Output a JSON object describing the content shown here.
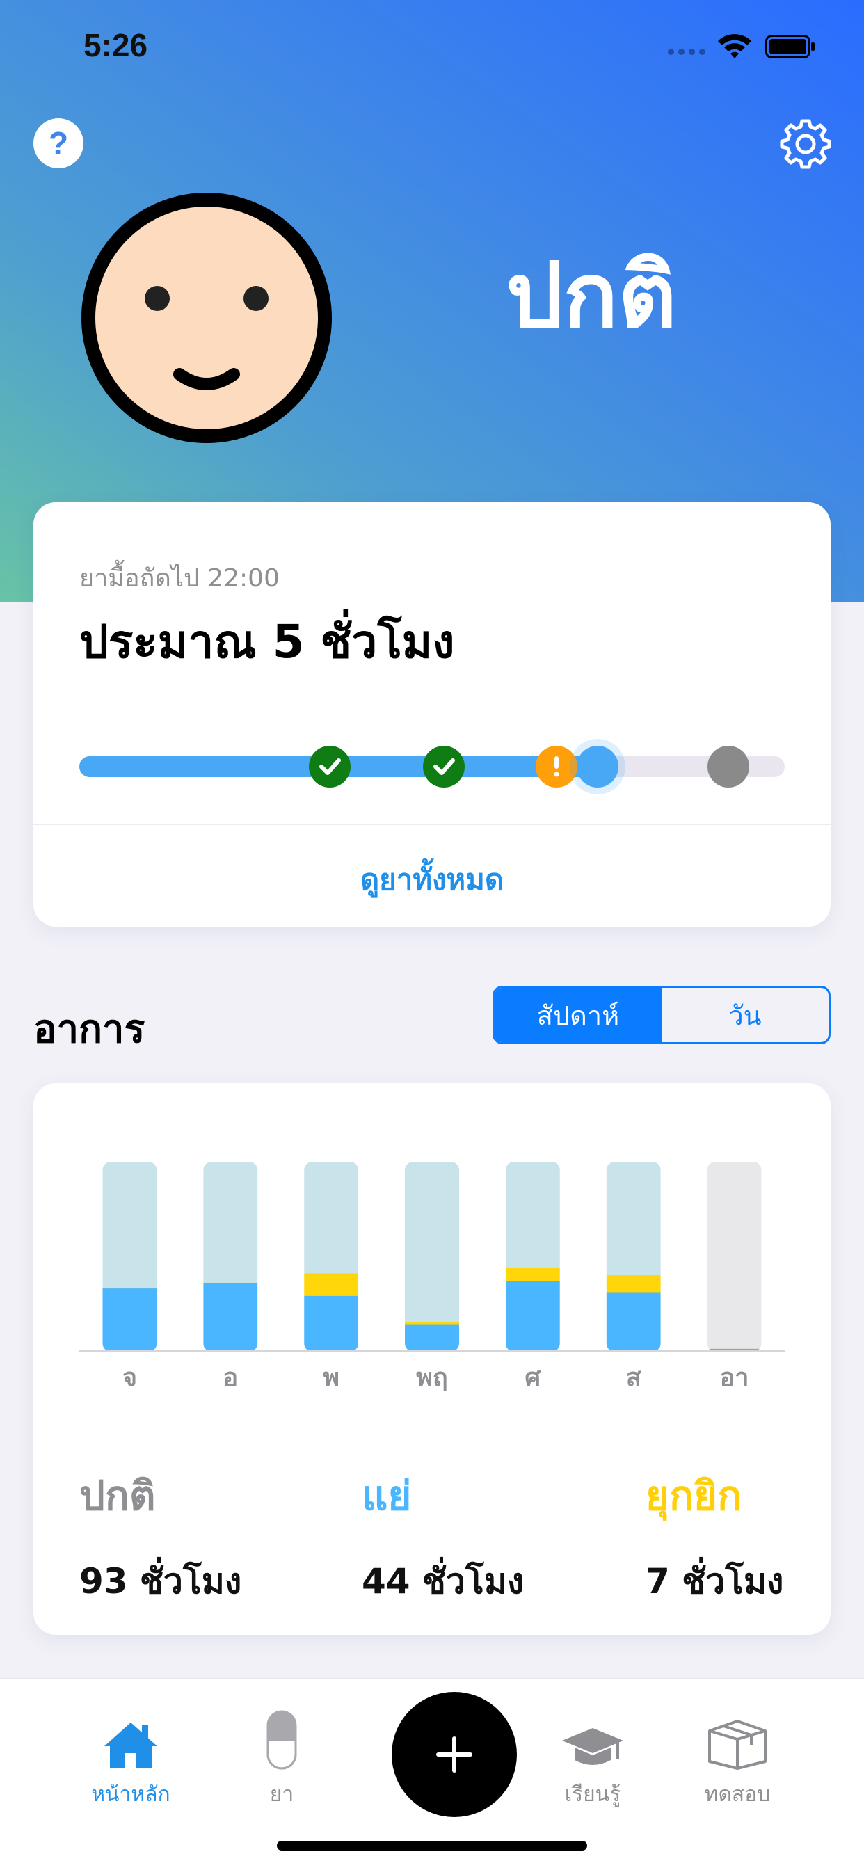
{
  "status_bar": {
    "time": "5:26"
  },
  "header": {
    "mood_label": "ปกติ"
  },
  "medication": {
    "next_label": "ยามื้อถัดไป 22:00",
    "time_remaining": "ประมาณ 5 ชั่วโมง",
    "see_all_label": "ดูยาทั้งหมด",
    "progress": 0.735,
    "doses": [
      {
        "status": "taken",
        "position": 0.355
      },
      {
        "status": "taken",
        "position": 0.517
      },
      {
        "status": "warning",
        "position": 0.677
      },
      {
        "status": "upcoming",
        "position": 0.92
      }
    ]
  },
  "symptoms": {
    "title": "อาการ",
    "segments": [
      "สัปดาห์",
      "วัน"
    ],
    "active_segment": 0,
    "legend": [
      {
        "name": "ปกติ",
        "value": "93 ชั่วโมง"
      },
      {
        "name": "แย่",
        "value": "44 ชั่วโมง"
      },
      {
        "name": "ยุกยิก",
        "value": "7 ชั่วโมง"
      }
    ]
  },
  "chart_data": {
    "type": "bar",
    "stacked": true,
    "categories": [
      "จ",
      "อ",
      "พ",
      "พฤ",
      "ศ",
      "ส",
      "อา"
    ],
    "series": [
      {
        "values": [
          33,
          36,
          29,
          14,
          37,
          31,
          1
        ],
        "color": "#49b6ff"
      },
      {
        "values": [
          0,
          0,
          12,
          1,
          7,
          9,
          0
        ],
        "color": "#ffd60a"
      },
      {
        "values": [
          67,
          64,
          59,
          85,
          56,
          60,
          99
        ],
        "color": "#c8e4ea"
      }
    ],
    "ylim": [
      0,
      100
    ]
  },
  "tabbar": {
    "items": [
      "หน้าหลัก",
      "ยา",
      "เรียนรู้",
      "ทดสอบ"
    ],
    "active": 0
  },
  "colors": {
    "accent": "#1f8fe8",
    "taken": "#0f7d14",
    "warning": "#ff9f0a",
    "bad": "#49b6ff",
    "dyskinesia": "#ffd60a"
  }
}
